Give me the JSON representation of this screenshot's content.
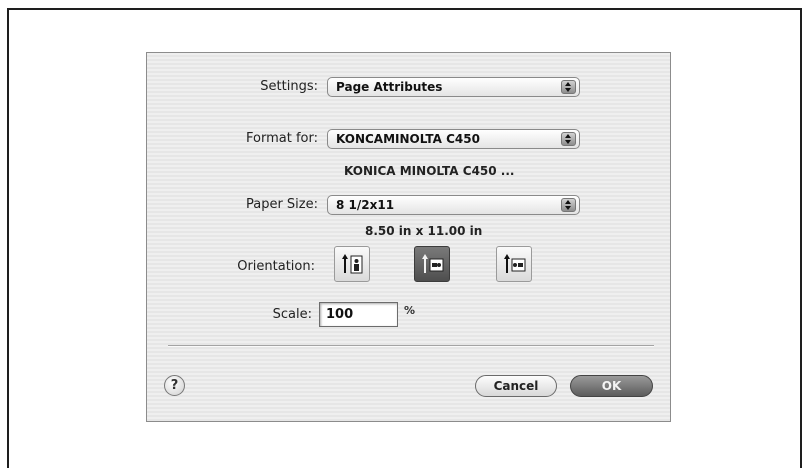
{
  "settings": {
    "label": "Settings:",
    "value": "Page Attributes"
  },
  "format_for": {
    "label": "Format for:",
    "value": "KONCAMINOLTA C450",
    "description": "KONICA MINOLTA C450 ..."
  },
  "paper_size": {
    "label": "Paper Size:",
    "value": "8 1/2x11",
    "dimensions": "8.50 in x 11.00 in"
  },
  "orientation": {
    "label": "Orientation:",
    "options": [
      {
        "name": "portrait",
        "selected": false
      },
      {
        "name": "landscape-left",
        "selected": true
      },
      {
        "name": "landscape-right",
        "selected": false
      }
    ]
  },
  "scale": {
    "label": "Scale:",
    "value": "100",
    "unit": "%"
  },
  "buttons": {
    "help": "?",
    "cancel": "Cancel",
    "ok": "OK"
  }
}
